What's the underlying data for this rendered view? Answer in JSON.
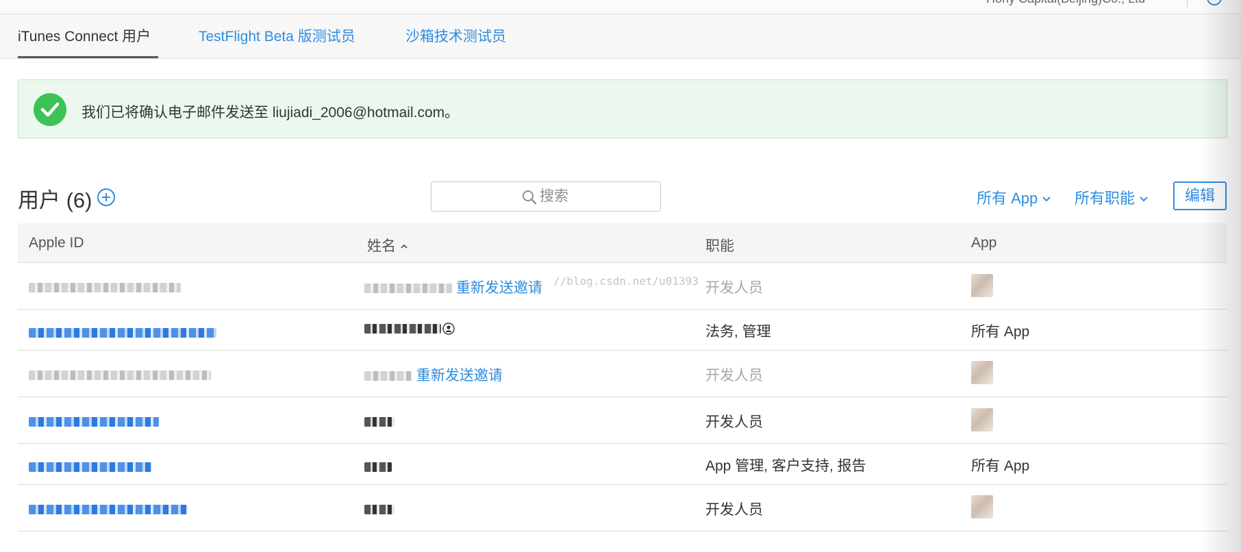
{
  "header": {
    "company": "Hony Capital(Beijing)Co., Ltd"
  },
  "tabs": [
    {
      "label": "iTunes Connect 用户",
      "active": true
    },
    {
      "label": "TestFlight Beta 版测试员",
      "active": false
    },
    {
      "label": "沙箱技术测试员",
      "active": false
    }
  ],
  "alert": {
    "message": "我们已将确认电子邮件发送至 liujiadi_2006@hotmail.com。",
    "status_color": "#3dc257"
  },
  "users": {
    "title": "用户 (6)",
    "search_placeholder": "搜索",
    "filter_apps": "所有 App",
    "filter_roles": "所有职能",
    "edit_label": "编辑"
  },
  "table": {
    "columns": [
      "Apple ID",
      "姓名",
      "职能",
      "App"
    ],
    "sorted_column": "姓名",
    "sort_direction": "ascending",
    "rows": [
      {
        "apple_id": "",
        "name": "",
        "action": "重新发送邀请",
        "role": "开发人员",
        "app": "",
        "pending": true,
        "has_thumb": true
      },
      {
        "apple_id": "",
        "name": "",
        "action": "",
        "role": "法务, 管理",
        "app": "所有 App",
        "pending": false,
        "has_thumb": false
      },
      {
        "apple_id": "",
        "name": "",
        "action": "重新发送邀请",
        "role": "开发人员",
        "app": "",
        "pending": true,
        "has_thumb": true
      },
      {
        "apple_id": "",
        "name": "",
        "action": "",
        "role": "开发人员",
        "app": "",
        "pending": false,
        "has_thumb": true
      },
      {
        "apple_id": "",
        "name": "",
        "action": "",
        "role": "App 管理, 客户支持, 报告",
        "app": "所有 App",
        "pending": false,
        "has_thumb": false
      },
      {
        "apple_id": "",
        "name": "",
        "action": "",
        "role": "开发人员",
        "app": "",
        "pending": false,
        "has_thumb": true
      }
    ]
  },
  "watermark": "//blog.csdn.net/u01393",
  "colors": {
    "accent": "#2e8be0",
    "success": "#3dc257",
    "alert_bg": "#ecf8ee",
    "muted_text": "#a6a6a6"
  }
}
